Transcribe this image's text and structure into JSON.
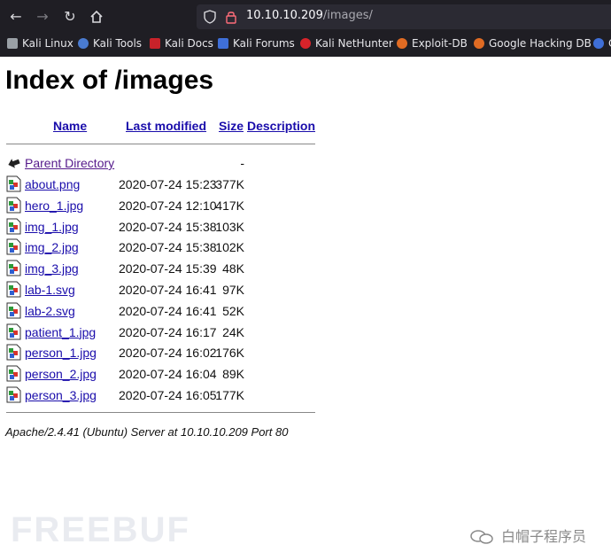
{
  "browser": {
    "url_host": "10.10.10.209",
    "url_path": "/images/",
    "bookmarks": [
      {
        "label": "Kali Linux",
        "color": "#9aa0a6"
      },
      {
        "label": "Kali Tools",
        "color": "#4a7bd0"
      },
      {
        "label": "Kali Docs",
        "color": "#c8222a"
      },
      {
        "label": "Kali Forums",
        "color": "#3f6fd8"
      },
      {
        "label": "Kali NetHunter",
        "color": "#d8232a"
      },
      {
        "label": "Exploit-DB",
        "color": "#e06b23"
      },
      {
        "label": "Google Hacking DB",
        "color": "#e06b23"
      },
      {
        "label": "C",
        "color": "#3f6fd8"
      }
    ]
  },
  "page": {
    "title": "Index of /images",
    "columns": {
      "name": "Name",
      "modified": "Last modified",
      "size": "Size",
      "description": "Description"
    },
    "parent": {
      "name": "Parent Directory",
      "size": "-"
    },
    "files": [
      {
        "name": "about.png",
        "modified": "2020-07-24 15:23",
        "size": "377K"
      },
      {
        "name": "hero_1.jpg",
        "modified": "2020-07-24 12:10",
        "size": "417K"
      },
      {
        "name": "img_1.jpg",
        "modified": "2020-07-24 15:38",
        "size": "103K"
      },
      {
        "name": "img_2.jpg",
        "modified": "2020-07-24 15:38",
        "size": "102K"
      },
      {
        "name": "img_3.jpg",
        "modified": "2020-07-24 15:39",
        "size": "48K"
      },
      {
        "name": "lab-1.svg",
        "modified": "2020-07-24 16:41",
        "size": "97K"
      },
      {
        "name": "lab-2.svg",
        "modified": "2020-07-24 16:41",
        "size": "52K"
      },
      {
        "name": "patient_1.jpg",
        "modified": "2020-07-24 16:17",
        "size": "24K"
      },
      {
        "name": "person_1.jpg",
        "modified": "2020-07-24 16:02",
        "size": "176K"
      },
      {
        "name": "person_2.jpg",
        "modified": "2020-07-24 16:04",
        "size": "89K"
      },
      {
        "name": "person_3.jpg",
        "modified": "2020-07-24 16:05",
        "size": "177K"
      }
    ],
    "address": "Apache/2.4.41 (Ubuntu) Server at 10.10.10.209 Port 80"
  },
  "watermark": {
    "left": "FREEBUF",
    "right": "白帽子程序员"
  }
}
